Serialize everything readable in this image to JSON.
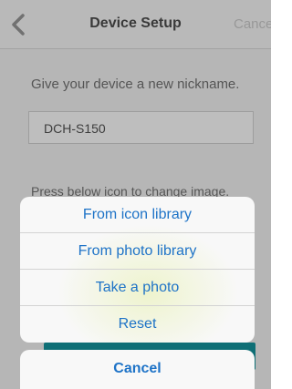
{
  "navbar": {
    "title": "Device Setup",
    "cancel_label": "Cance"
  },
  "form": {
    "prompt": "Give your device a new nickname.",
    "nickname_value": "DCH-S150",
    "hint": "Press below icon to change image."
  },
  "action_sheet": {
    "items": [
      {
        "label": "From icon library"
      },
      {
        "label": "From photo library"
      },
      {
        "label": "Take a photo"
      },
      {
        "label": "Reset"
      }
    ],
    "cancel_label": "Cancel"
  },
  "colors": {
    "accent": "#1e73c7",
    "teal": "#0f6f76"
  },
  "icons": {
    "back": "chevron-left-icon"
  }
}
